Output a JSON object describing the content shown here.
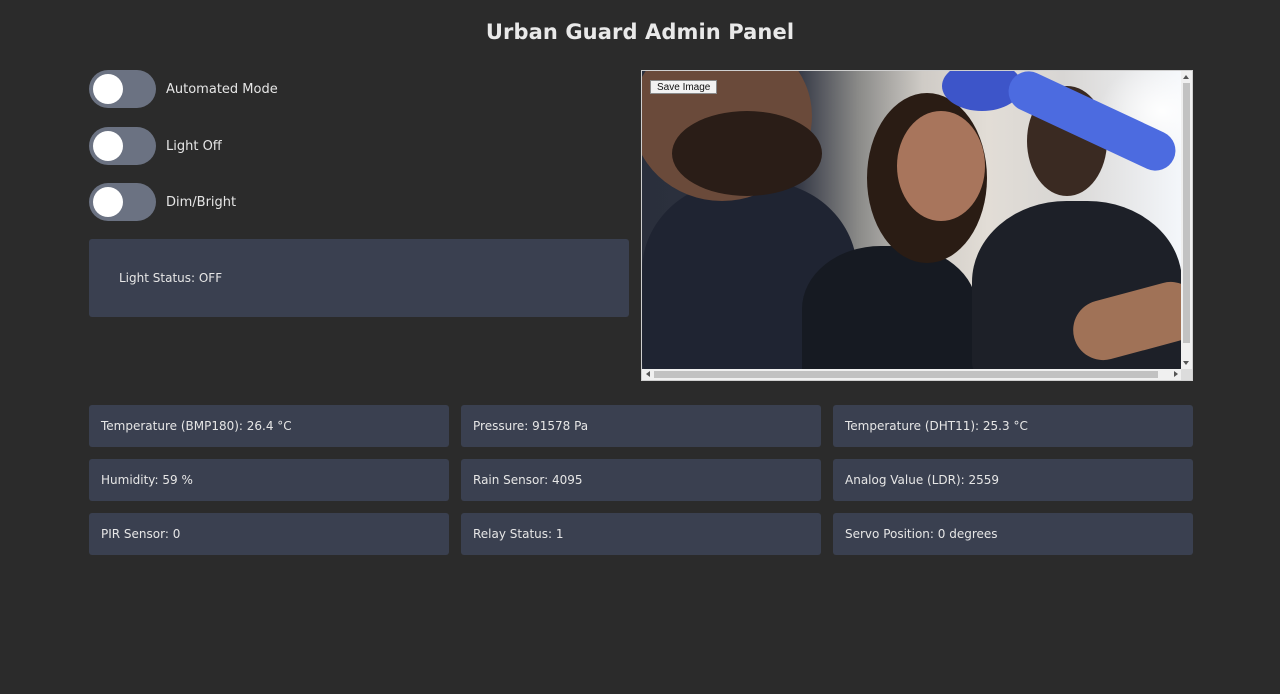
{
  "page": {
    "title": "Urban Guard Admin Panel"
  },
  "toggles": [
    {
      "label": "Automated Mode",
      "on": false
    },
    {
      "label": "Light Off",
      "on": false
    },
    {
      "label": "Dim/Bright",
      "on": false
    }
  ],
  "light_status": {
    "text": "Light Status: OFF"
  },
  "camera": {
    "save_button_label": "Save Image"
  },
  "sensors": [
    {
      "text": "Temperature (BMP180): 26.4 °C"
    },
    {
      "text": "Pressure: 91578 Pa"
    },
    {
      "text": "Temperature (DHT11): 25.3 °C"
    },
    {
      "text": "Humidity: 59 %"
    },
    {
      "text": "Rain Sensor: 4095"
    },
    {
      "text": "Analog Value (LDR): 2559"
    },
    {
      "text": "PIR Sensor: 0"
    },
    {
      "text": "Relay Status: 1"
    },
    {
      "text": "Servo Position: 0 degrees"
    }
  ],
  "colors": {
    "background": "#2b2b2b",
    "card": "#3a4050",
    "switch_track": "#6b7282",
    "knob": "#ffffff"
  }
}
